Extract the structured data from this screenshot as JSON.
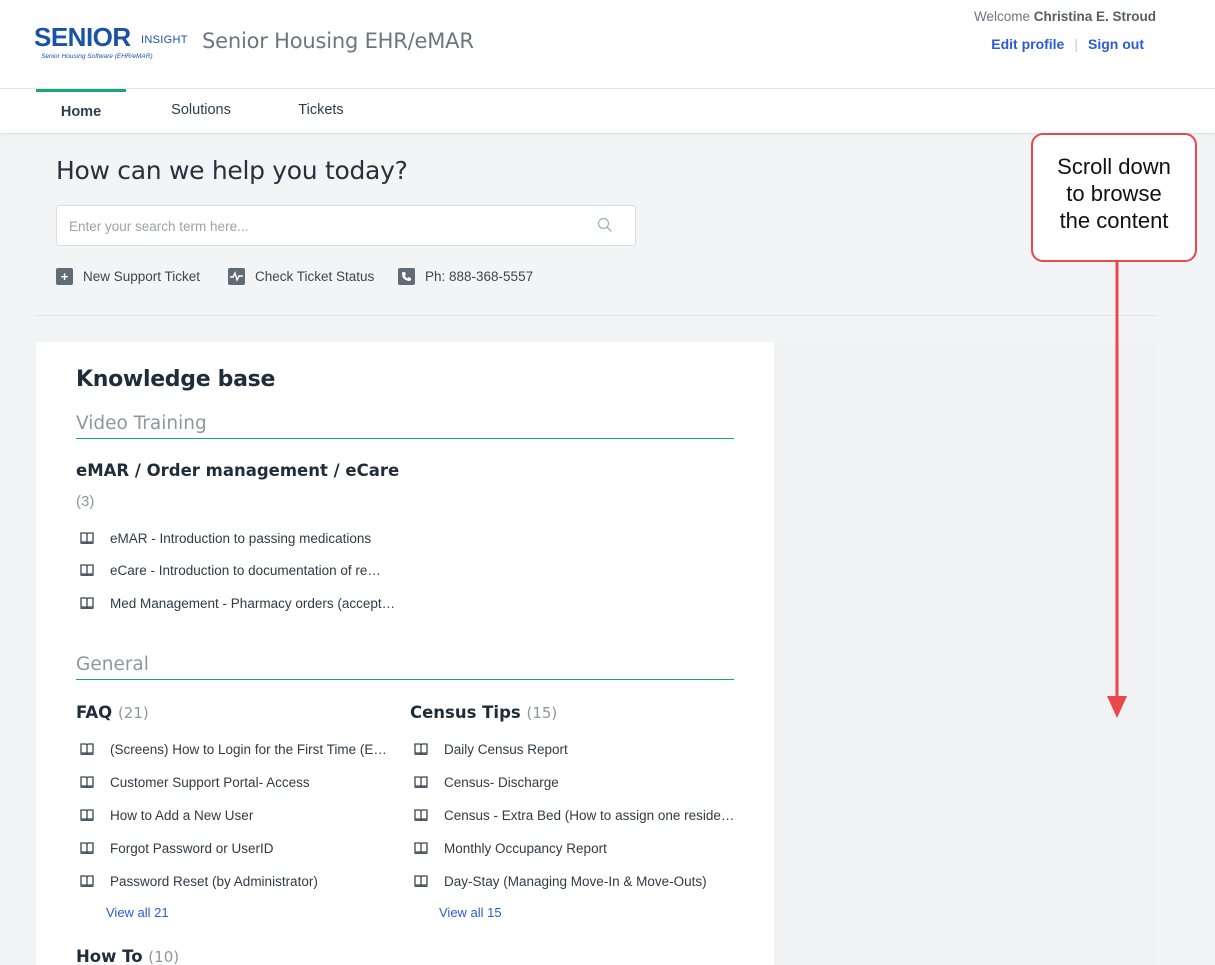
{
  "header": {
    "logo": {
      "brand": "SENIOR",
      "suffix": "INSIGHT",
      "tagline": "Senior Housing Software (EHR/eMAR)"
    },
    "app_title": "Senior Housing EHR/eMAR",
    "welcome_prefix": "Welcome",
    "user_name": "Christina E. Stroud",
    "edit_profile": "Edit profile",
    "sign_out": "Sign out"
  },
  "nav": {
    "home": "Home",
    "solutions": "Solutions",
    "tickets": "Tickets"
  },
  "hero": {
    "title": "How can we help you today?",
    "search_placeholder": "Enter your search term here...",
    "new_ticket": "New Support Ticket",
    "check_status": "Check Ticket Status",
    "phone": "Ph: 888-368-5557"
  },
  "kb": {
    "title": "Knowledge base",
    "video_training": {
      "heading": "Video Training",
      "folder": {
        "title": "eMAR / Order management / eCare",
        "count": "(3)"
      },
      "articles": [
        "eMAR - Introduction to passing medications",
        "eCare - Introduction to documentation of re…",
        "Med Management - Pharmacy orders (accept…"
      ]
    },
    "general": {
      "heading": "General",
      "faq": {
        "title": "FAQ",
        "count": "(21)",
        "articles": [
          "(Screens) How to Login for the First Time (E…",
          "Customer Support Portal- Access",
          "How to Add a New User",
          "Forgot Password or UserID",
          "Password Reset (by Administrator)"
        ],
        "view_all": "View all 21"
      },
      "census": {
        "title": "Census Tips",
        "count": "(15)",
        "articles": [
          "Daily Census Report",
          "Census- Discharge",
          "Census - Extra Bed (How to assign one reside…",
          "Monthly Occupancy Report",
          "Day-Stay (Managing Move-In & Move-Outs)"
        ],
        "view_all": "View all 15"
      },
      "howto": {
        "title": "How To",
        "count": "(10)"
      }
    }
  },
  "callout": {
    "text_line1": "Scroll down",
    "text_line2": "to browse",
    "text_line3": "the content"
  },
  "colors": {
    "accent": "#17a57d",
    "link": "#2a5bd7",
    "callout": "#e8474c"
  }
}
